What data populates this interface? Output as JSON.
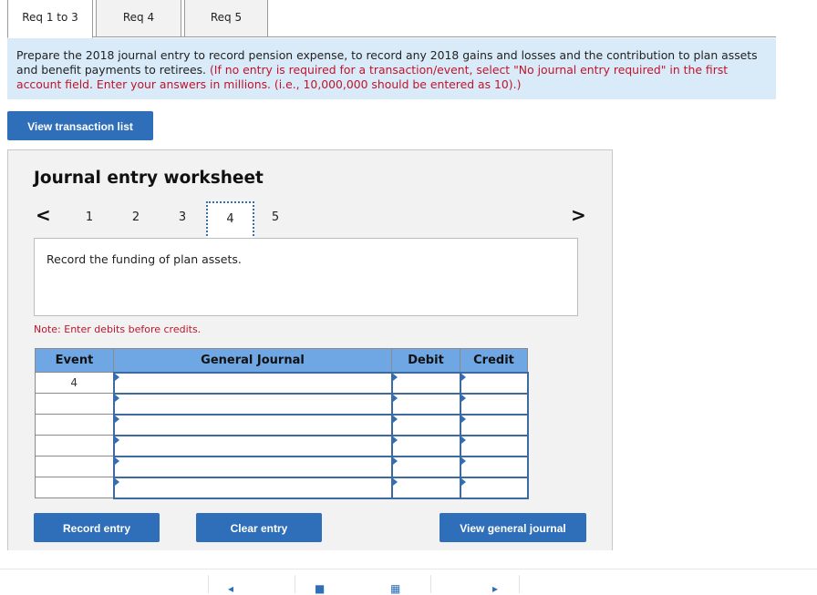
{
  "tabs": [
    {
      "label": "Req 1 to 3",
      "active": true
    },
    {
      "label": "Req 4",
      "active": false
    },
    {
      "label": "Req 5",
      "active": false
    }
  ],
  "instructions": {
    "main": "Prepare the 2018 journal entry to record pension expense, to record any 2018 gains and losses and the contribution to plan assets and benefit payments to retirees.",
    "note": "(If no entry is required for a transaction/event, select \"No journal entry required\" in the first account field. Enter your answers in millions. (i.e., 10,000,000 should be entered as 10).)"
  },
  "buttons": {
    "view_transaction_list": "View transaction list",
    "record_entry": "Record entry",
    "clear_entry": "Clear entry",
    "view_general_journal": "View general journal"
  },
  "worksheet": {
    "title": "Journal entry worksheet",
    "nav_prev": "<",
    "nav_next": ">",
    "steps": [
      "1",
      "2",
      "3",
      "4",
      "5"
    ],
    "active_step": "4",
    "description": "Record the funding of plan assets.",
    "note": "Note: Enter debits before credits."
  },
  "journal_table": {
    "headers": [
      "Event",
      "General Journal",
      "Debit",
      "Credit"
    ],
    "rows": [
      {
        "event": "4",
        "account": "",
        "debit": "",
        "credit": ""
      },
      {
        "event": "",
        "account": "",
        "debit": "",
        "credit": ""
      },
      {
        "event": "",
        "account": "",
        "debit": "",
        "credit": ""
      },
      {
        "event": "",
        "account": "",
        "debit": "",
        "credit": ""
      },
      {
        "event": "",
        "account": "",
        "debit": "",
        "credit": ""
      },
      {
        "event": "",
        "account": "",
        "debit": "",
        "credit": ""
      }
    ]
  },
  "colors": {
    "accent": "#2f6fba",
    "header_blue": "#6fa7e4",
    "instruction_bg": "#d9eaf8",
    "note_red": "#c0142b"
  }
}
